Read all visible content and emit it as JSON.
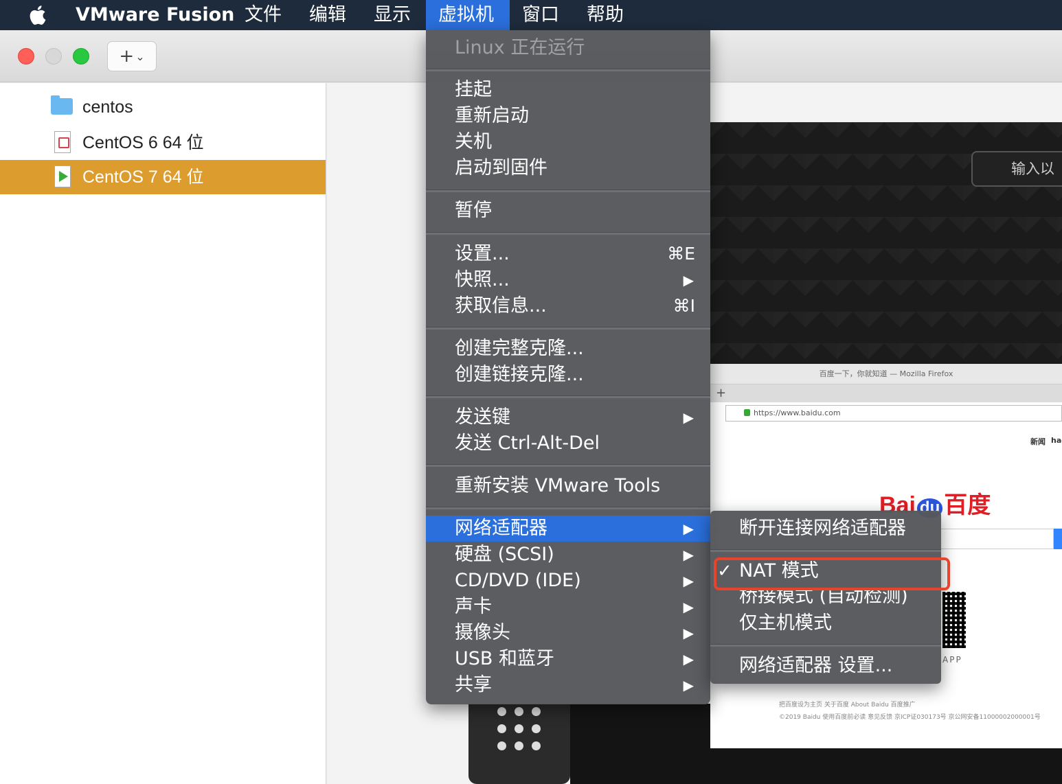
{
  "menubar": {
    "apple": "",
    "app_name": "VMware Fusion",
    "items": [
      "文件",
      "编辑",
      "显示",
      "虚拟机",
      "窗口",
      "帮助"
    ]
  },
  "toolbar": {
    "add_label": "+",
    "add_chevron": "⌄"
  },
  "sidebar": {
    "items": [
      {
        "label": "centos",
        "icon": "folder-icon"
      },
      {
        "label": "CentOS 6 64 位",
        "icon": "vm-off-icon"
      },
      {
        "label": "CentOS 7 64 位",
        "icon": "vm-running-icon",
        "selected": true
      }
    ]
  },
  "vm_menu": {
    "status": "Linux 正在运行",
    "suspend": "挂起",
    "restart": "重新启动",
    "shutdown": "关机",
    "boot_firmware": "启动到固件",
    "pause": "暂停",
    "settings": "设置...",
    "settings_shortcut": "⌘E",
    "snapshots": "快照...",
    "get_info": "获取信息...",
    "get_info_shortcut": "⌘I",
    "full_clone": "创建完整克隆...",
    "linked_clone": "创建链接克隆...",
    "send_key": "发送键",
    "send_cad": "发送 Ctrl-Alt-Del",
    "reinstall_tools": "重新安装 VMware Tools",
    "network_adapter": "网络适配器",
    "hard_disk": "硬盘 (SCSI)",
    "cd_dvd": "CD/DVD (IDE)",
    "sound_card": "声卡",
    "camera": "摄像头",
    "usb_bluetooth": "USB 和蓝牙",
    "sharing": "共享",
    "arrow": "▶"
  },
  "network_submenu": {
    "disconnect": "断开连接网络适配器",
    "nat": "NAT 模式",
    "nat_check": "✓",
    "bridged": "桥接模式 (自动检测)",
    "host_only": "仅主机模式",
    "adapter_settings": "网络适配器 设置..."
  },
  "guest": {
    "login_prompt": "输入以",
    "firefox_title": "百度一下，你就知道 — Mozilla Firefox",
    "new_tab": "+",
    "url": "https://www.baidu.com",
    "nav_links": [
      "新闻",
      "hao"
    ],
    "baidu_bai": "Bai",
    "baidu_du": "du",
    "baidu_cn": "百度",
    "app_label": "APP",
    "footer_line1": "把百度设为主页    关于百度    About Baidu    百度推广",
    "footer_line2": "©2019 Baidu 使用百度前必读 意见反馈 京ICP证030173号  京公网安备11000002000001号"
  },
  "colors": {
    "menubar_bg": "#1d2b3c",
    "highlight_blue": "#2a6fdb",
    "selected_orange": "#dd9c2e",
    "callout_red": "#e8432d"
  }
}
